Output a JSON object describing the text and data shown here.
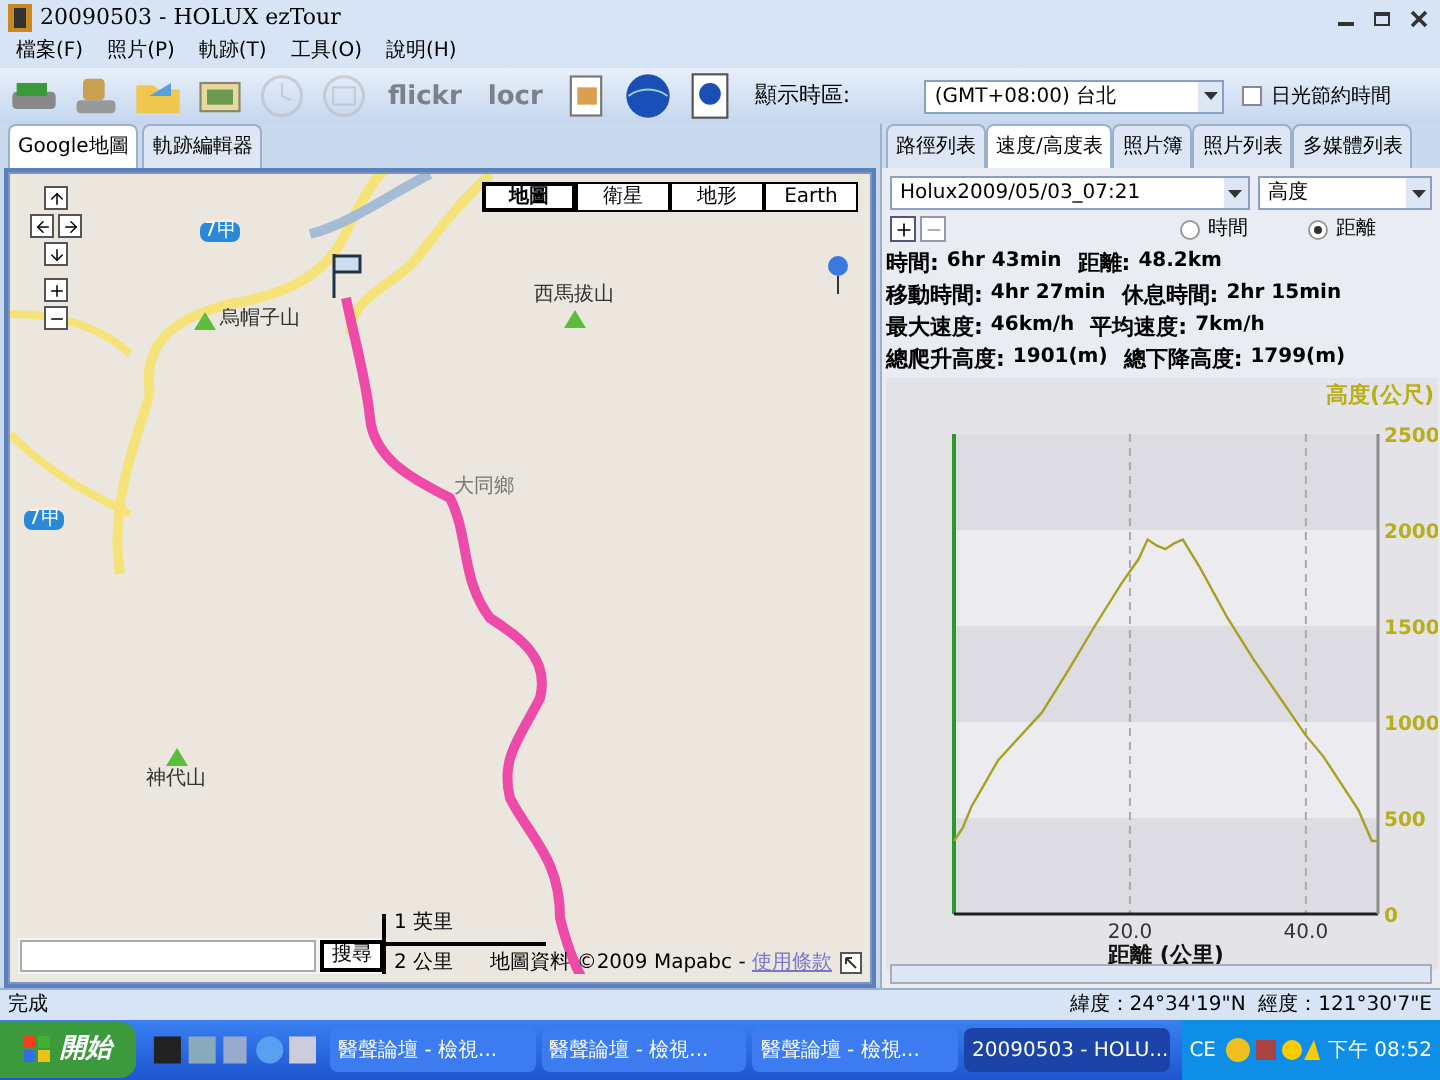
{
  "window": {
    "title": "20090503 - HOLUX ezTour"
  },
  "menu": [
    "檔案(F)",
    "照片(P)",
    "軌跡(T)",
    "工具(O)",
    "說明(H)"
  ],
  "toolbar": {
    "buttons": [
      {
        "kind": "drive",
        "disabled": false
      },
      {
        "kind": "usb",
        "disabled": false
      },
      {
        "kind": "folder",
        "disabled": false
      },
      {
        "kind": "photos",
        "disabled": false
      },
      {
        "kind": "clock",
        "disabled": true
      },
      {
        "kind": "camera",
        "disabled": true
      },
      {
        "kind": "flickr",
        "label": "flickr",
        "disabled": true
      },
      {
        "kind": "locr",
        "label": "locr",
        "disabled": true
      },
      {
        "kind": "document",
        "disabled": false
      },
      {
        "kind": "globe",
        "disabled": false
      },
      {
        "kind": "kmz",
        "disabled": false
      }
    ],
    "timezone_label": "顯示時區:",
    "timezone": "(GMT+08:00) 台北",
    "dst": {
      "label": "日光節約時間",
      "checked": false
    }
  },
  "left_tabs": [
    {
      "label": "Google地圖",
      "selected": true
    },
    {
      "label": "軌跡編輯器",
      "selected": false
    }
  ],
  "map": {
    "types": [
      {
        "label": "地圖",
        "selected": true
      },
      {
        "label": "衛星",
        "selected": false
      },
      {
        "label": "地形",
        "selected": false
      },
      {
        "label": "Earth",
        "selected": false
      }
    ],
    "places": [
      {
        "text": "7甲",
        "kind": "shield"
      },
      {
        "text": "西馬拔山",
        "kind": "peak"
      },
      {
        "text": "烏帽子山",
        "kind": "peak"
      },
      {
        "text": "大同鄉",
        "kind": "town"
      },
      {
        "text": "7甲",
        "kind": "shield"
      },
      {
        "text": "神代山",
        "kind": "peak"
      }
    ],
    "search_button": "搜尋",
    "scale": [
      "1 英里",
      "2 公里"
    ],
    "attribution": "地圖資料 ©2009 Mapabc - ",
    "terms_link": "使用條款"
  },
  "right_tabs": [
    {
      "label": "路徑列表",
      "selected": false
    },
    {
      "label": "速度/高度表",
      "selected": true
    },
    {
      "label": "照片簿",
      "selected": false
    },
    {
      "label": "照片列表",
      "selected": false
    },
    {
      "label": "多媒體列表",
      "selected": false
    }
  ],
  "track_select": "Holux2009/05/03_07:21",
  "measure_select": "高度",
  "axis_options": [
    {
      "label": "時間",
      "selected": false
    },
    {
      "label": "距離",
      "selected": true
    }
  ],
  "stats": [
    [
      {
        "label": "時間:",
        "value": "6hr 43min"
      },
      {
        "label": "距離:",
        "value": "48.2km"
      }
    ],
    [
      {
        "label": "移動時間:",
        "value": "4hr 27min"
      },
      {
        "label": "休息時間:",
        "value": "2hr 15min"
      }
    ],
    [
      {
        "label": "最大速度:",
        "value": "46km/h"
      },
      {
        "label": "平均速度:",
        "value": "7km/h"
      }
    ],
    [
      {
        "label": "總爬升高度:",
        "value": "1901(m)"
      },
      {
        "label": "總下降高度:",
        "value": "1799(m)"
      }
    ]
  ],
  "chart_data": {
    "type": "line",
    "xlabel": "距離 (公里)",
    "ylabel": "高度(公尺)",
    "xlim": [
      0,
      48.2
    ],
    "ylim": [
      0,
      2500
    ],
    "xticks": [
      {
        "value": 20,
        "label": "20.0"
      },
      {
        "value": 40,
        "label": "40.0"
      }
    ],
    "yticks": [
      0,
      500,
      1000,
      1500,
      2000,
      2500
    ],
    "x": [
      0,
      1,
      2,
      3,
      5,
      8,
      10,
      13,
      16,
      19,
      21,
      22,
      23,
      24,
      25,
      26,
      28,
      31,
      34,
      37,
      40,
      42,
      44,
      46,
      47.5,
      48.2
    ],
    "series": [
      {
        "color": "#a8a020",
        "values": [
          380,
          450,
          560,
          640,
          800,
          950,
          1050,
          1270,
          1500,
          1720,
          1850,
          1950,
          1920,
          1900,
          1930,
          1950,
          1800,
          1550,
          1330,
          1130,
          930,
          820,
          680,
          540,
          380,
          380
        ]
      }
    ]
  },
  "status_bar": {
    "text": "完成",
    "coords": "緯度：24°34'19\"N  經度：121°30'7\"E"
  },
  "taskbar": {
    "start": "開始",
    "tasks": [
      {
        "label": "醫聲論壇 - 檢視...",
        "selected": false
      },
      {
        "label": "醫聲論壇 - 檢視...",
        "selected": false
      },
      {
        "label": "醫聲論壇 - 檢視...",
        "selected": false
      },
      {
        "label": "20090503 - HOLU...",
        "selected": true
      }
    ],
    "lang": "CE",
    "clock": "下午 08:52"
  }
}
